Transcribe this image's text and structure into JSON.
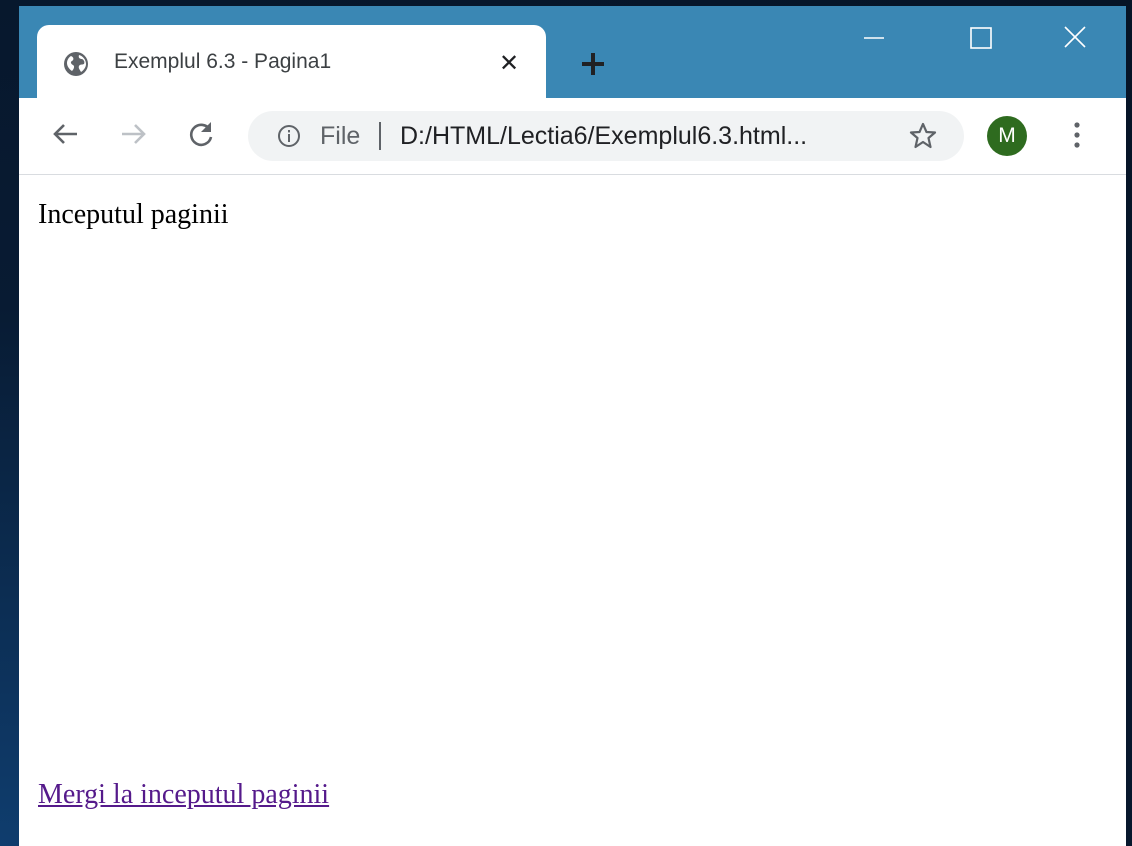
{
  "tab": {
    "title": "Exemplul 6.3 - Pagina1",
    "close_symbol": "✕",
    "favicon": "globe-icon"
  },
  "toolbar": {
    "scheme_label": "File",
    "url": "D:/HTML/Lectia6/Exemplul6.3.html...",
    "avatar_letter": "M"
  },
  "page": {
    "top_text": "Inceputul paginii",
    "link_text": "Mergi la inceputul paginii"
  },
  "colors": {
    "titlebar": "#3a87b4",
    "avatar": "#2e6b1f",
    "visited_link": "#551a8b"
  }
}
